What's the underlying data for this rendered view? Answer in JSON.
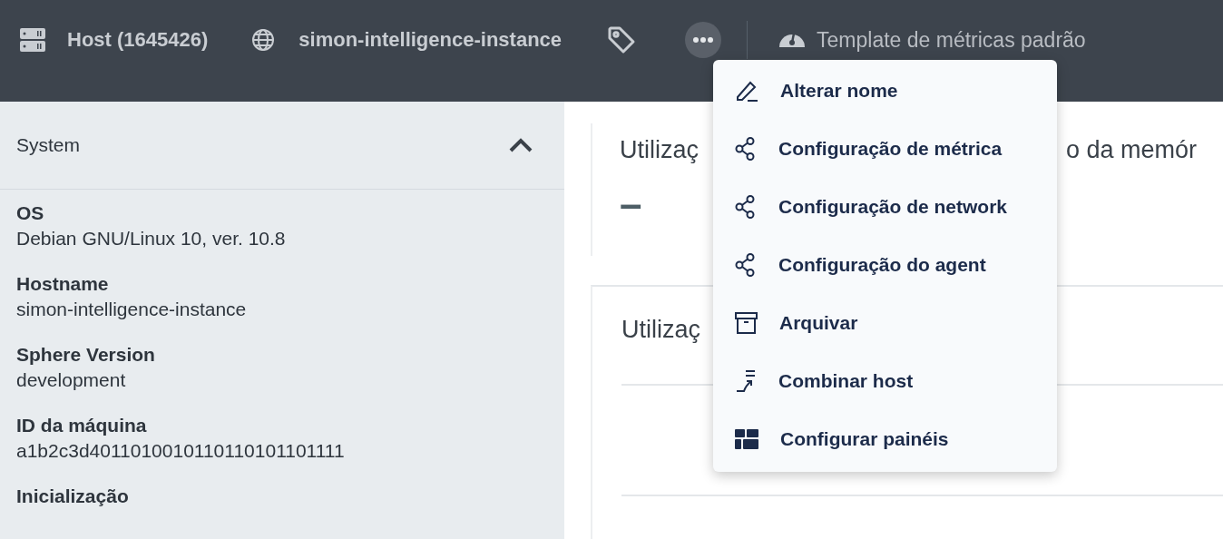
{
  "header": {
    "host": "Host (1645426)",
    "instance": "simon-intelligence-instance",
    "more_menu": {
      "expanded": true,
      "items": [
        {
          "kind": "edit",
          "label": "Alterar nome"
        },
        {
          "kind": "share",
          "label": "Configuração de métrica"
        },
        {
          "kind": "share",
          "label": "Configuração de network"
        },
        {
          "kind": "share",
          "label": "Configuração do agent"
        },
        {
          "kind": "archive",
          "label": "Arquivar"
        },
        {
          "kind": "merge",
          "label": "Combinar host"
        },
        {
          "kind": "panels",
          "label": "Configurar painéis"
        }
      ]
    },
    "template": "Template de métricas padrão"
  },
  "sidebar": {
    "title": "System",
    "expanded": true,
    "fields": [
      {
        "label": "OS",
        "value": "Debian GNU/Linux 10, ver. 10.8"
      },
      {
        "label": "Hostname",
        "value": "simon-intelligence-instance"
      },
      {
        "label": "Sphere Version",
        "value": "development"
      },
      {
        "label": "ID da máquina",
        "value": "a1b2c3d4011010010110110101101111"
      },
      {
        "label": "Inicialização"
      }
    ]
  },
  "cards": [
    {
      "title_parts": [
        "Utilizaç",
        "o da memór"
      ],
      "value": "–"
    },
    {
      "title_parts": [
        "Utilizaç"
      ]
    }
  ]
}
